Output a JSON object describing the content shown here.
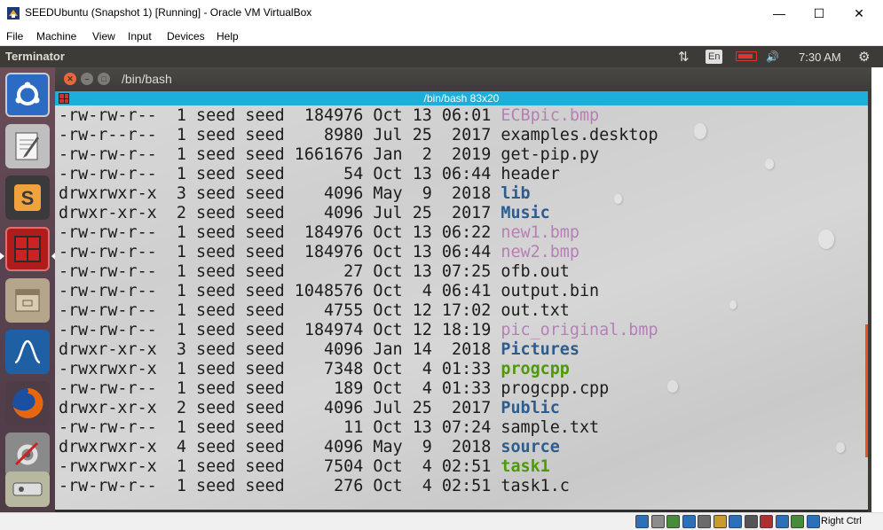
{
  "host_window": {
    "title": "SEEDUbuntu (Snapshot 1) [Running] - Oracle VM VirtualBox",
    "controls": {
      "minimize": "—",
      "maximize": "☐",
      "close": "✕"
    },
    "menu": [
      "File",
      "Machine",
      "View",
      "Input",
      "Devices",
      "Help"
    ]
  },
  "ubuntu_panel": {
    "app_title": "Terminator",
    "language": "En",
    "time": "7:30 AM",
    "icons": {
      "network": "⇅",
      "volume": "🔊",
      "settings": "⚙"
    }
  },
  "launcher": {
    "items": [
      {
        "name": "ubuntu-dash",
        "color": "#2b6bc4",
        "glyph": "◎"
      },
      {
        "name": "text-editor",
        "color": "#a9a9a9",
        "glyph": "✎"
      },
      {
        "name": "sublime-text",
        "color": "#3a3a3a",
        "glyph": "S"
      },
      {
        "name": "terminator",
        "color": "#b01c1c",
        "glyph": "▦"
      },
      {
        "name": "file-manager",
        "color": "#b5a58a",
        "glyph": "▭"
      },
      {
        "name": "wireshark",
        "color": "#1f5fa3",
        "glyph": "∿"
      },
      {
        "name": "firefox",
        "color": "#e8660d",
        "glyph": "◉"
      },
      {
        "name": "system-settings",
        "color": "#8a8a8a",
        "glyph": "⚙"
      }
    ]
  },
  "terminator": {
    "window_title": "/bin/bash",
    "tab_title": "/bin/bash 83x20",
    "colors": {
      "bmp": "#b580b5",
      "dir": "#2d5d8f",
      "exe": "#4e9a06",
      "plain": "#1c1c1c"
    },
    "listing": [
      {
        "perm": "-rw-rw-r--",
        "links": "1",
        "owner": "seed",
        "group": "seed",
        "size": "184976",
        "month": "Oct",
        "day": "13",
        "time": "06:01",
        "name": "ECBpic.bmp",
        "kind": "bmp"
      },
      {
        "perm": "-rw-r--r--",
        "links": "1",
        "owner": "seed",
        "group": "seed",
        "size": "8980",
        "month": "Jul",
        "day": "25",
        "time": "2017",
        "name": "examples.desktop",
        "kind": "plain"
      },
      {
        "perm": "-rw-rw-r--",
        "links": "1",
        "owner": "seed",
        "group": "seed",
        "size": "1661676",
        "month": "Jan",
        "day": "2",
        "time": "2019",
        "name": "get-pip.py",
        "kind": "plain"
      },
      {
        "perm": "-rw-rw-r--",
        "links": "1",
        "owner": "seed",
        "group": "seed",
        "size": "54",
        "month": "Oct",
        "day": "13",
        "time": "06:44",
        "name": "header",
        "kind": "plain"
      },
      {
        "perm": "drwxrwxr-x",
        "links": "3",
        "owner": "seed",
        "group": "seed",
        "size": "4096",
        "month": "May",
        "day": "9",
        "time": "2018",
        "name": "lib",
        "kind": "dir"
      },
      {
        "perm": "drwxr-xr-x",
        "links": "2",
        "owner": "seed",
        "group": "seed",
        "size": "4096",
        "month": "Jul",
        "day": "25",
        "time": "2017",
        "name": "Music",
        "kind": "dir"
      },
      {
        "perm": "-rw-rw-r--",
        "links": "1",
        "owner": "seed",
        "group": "seed",
        "size": "184976",
        "month": "Oct",
        "day": "13",
        "time": "06:22",
        "name": "new1.bmp",
        "kind": "bmp"
      },
      {
        "perm": "-rw-rw-r--",
        "links": "1",
        "owner": "seed",
        "group": "seed",
        "size": "184976",
        "month": "Oct",
        "day": "13",
        "time": "06:44",
        "name": "new2.bmp",
        "kind": "bmp"
      },
      {
        "perm": "-rw-rw-r--",
        "links": "1",
        "owner": "seed",
        "group": "seed",
        "size": "27",
        "month": "Oct",
        "day": "13",
        "time": "07:25",
        "name": "ofb.out",
        "kind": "plain"
      },
      {
        "perm": "-rw-rw-r--",
        "links": "1",
        "owner": "seed",
        "group": "seed",
        "size": "1048576",
        "month": "Oct",
        "day": "4",
        "time": "06:41",
        "name": "output.bin",
        "kind": "plain"
      },
      {
        "perm": "-rw-rw-r--",
        "links": "1",
        "owner": "seed",
        "group": "seed",
        "size": "4755",
        "month": "Oct",
        "day": "12",
        "time": "17:02",
        "name": "out.txt",
        "kind": "plain"
      },
      {
        "perm": "-rw-rw-r--",
        "links": "1",
        "owner": "seed",
        "group": "seed",
        "size": "184974",
        "month": "Oct",
        "day": "12",
        "time": "18:19",
        "name": "pic_original.bmp",
        "kind": "bmp"
      },
      {
        "perm": "drwxr-xr-x",
        "links": "3",
        "owner": "seed",
        "group": "seed",
        "size": "4096",
        "month": "Jan",
        "day": "14",
        "time": "2018",
        "name": "Pictures",
        "kind": "dir"
      },
      {
        "perm": "-rwxrwxr-x",
        "links": "1",
        "owner": "seed",
        "group": "seed",
        "size": "7348",
        "month": "Oct",
        "day": "4",
        "time": "01:33",
        "name": "progcpp",
        "kind": "exe"
      },
      {
        "perm": "-rw-rw-r--",
        "links": "1",
        "owner": "seed",
        "group": "seed",
        "size": "189",
        "month": "Oct",
        "day": "4",
        "time": "01:33",
        "name": "progcpp.cpp",
        "kind": "plain"
      },
      {
        "perm": "drwxr-xr-x",
        "links": "2",
        "owner": "seed",
        "group": "seed",
        "size": "4096",
        "month": "Jul",
        "day": "25",
        "time": "2017",
        "name": "Public",
        "kind": "dir"
      },
      {
        "perm": "-rw-rw-r--",
        "links": "1",
        "owner": "seed",
        "group": "seed",
        "size": "11",
        "month": "Oct",
        "day": "13",
        "time": "07:24",
        "name": "sample.txt",
        "kind": "plain"
      },
      {
        "perm": "drwxrwxr-x",
        "links": "4",
        "owner": "seed",
        "group": "seed",
        "size": "4096",
        "month": "May",
        "day": "9",
        "time": "2018",
        "name": "source",
        "kind": "dir"
      },
      {
        "perm": "-rwxrwxr-x",
        "links": "1",
        "owner": "seed",
        "group": "seed",
        "size": "7504",
        "month": "Oct",
        "day": "4",
        "time": "02:51",
        "name": "task1",
        "kind": "exe"
      },
      {
        "perm": "-rw-rw-r--",
        "links": "1",
        "owner": "seed",
        "group": "seed",
        "size": "276",
        "month": "Oct",
        "day": "4",
        "time": "02:51",
        "name": "task1.c",
        "kind": "plain"
      }
    ]
  },
  "status_bar": {
    "host_key": "Right Ctrl",
    "icons": [
      "hard-disk",
      "optical-drive",
      "audio",
      "network",
      "usb",
      "shared-folders",
      "display",
      "video-capture",
      "recording",
      "virtualization",
      "guest-additions",
      "mouse-integration"
    ]
  }
}
